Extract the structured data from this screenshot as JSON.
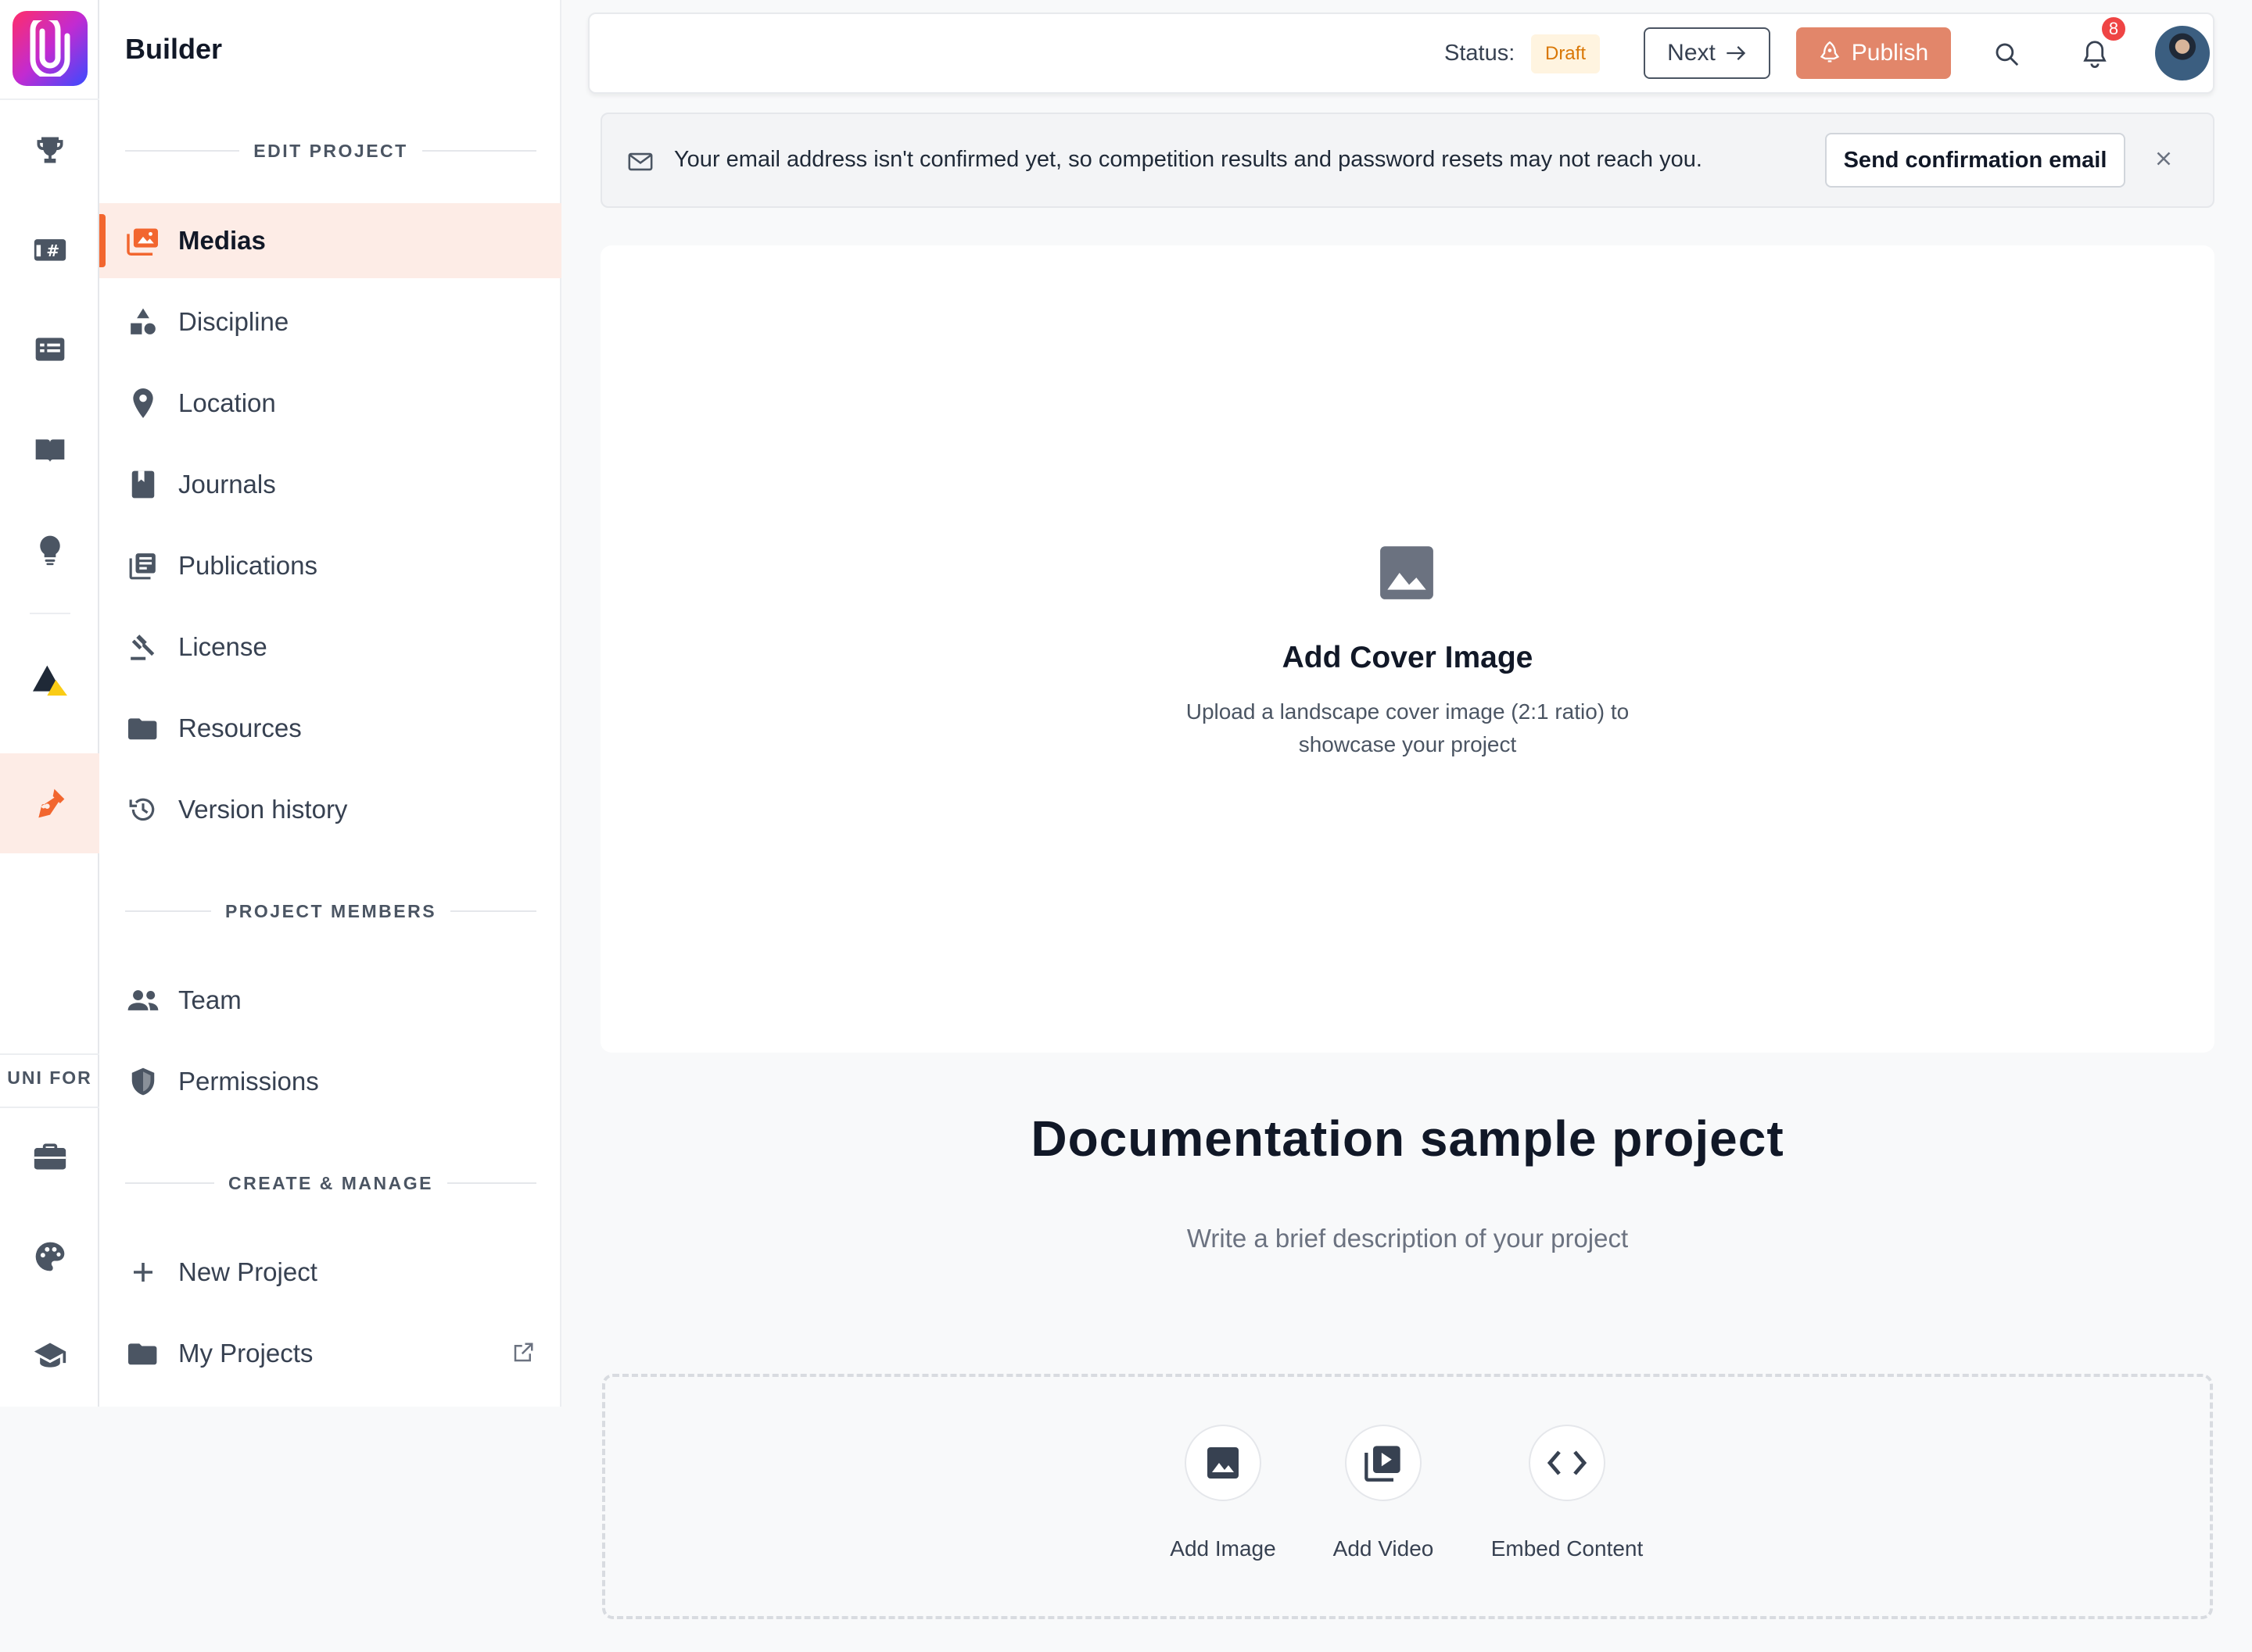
{
  "rail": {
    "icons": [
      "trophy-icon",
      "hashtag-card-icon",
      "news-icon",
      "book-open-icon",
      "lightbulb-icon",
      "brand-triangle-icon",
      "pen-nib-icon",
      "briefcase-icon",
      "palette-icon",
      "graduation-cap-icon"
    ],
    "section_label": "UNI FOR"
  },
  "sidebar": {
    "title": "Builder",
    "sections": {
      "edit_project": "EDIT PROJECT",
      "project_members": "PROJECT MEMBERS",
      "create_manage": "CREATE & MANAGE"
    },
    "items": [
      {
        "label": "Medias",
        "icon": "images-icon",
        "active": true
      },
      {
        "label": "Discipline",
        "icon": "shapes-icon"
      },
      {
        "label": "Location",
        "icon": "map-pin-icon"
      },
      {
        "label": "Journals",
        "icon": "journal-icon"
      },
      {
        "label": "Publications",
        "icon": "publications-icon"
      },
      {
        "label": "License",
        "icon": "gavel-icon"
      },
      {
        "label": "Resources",
        "icon": "folder-icon"
      },
      {
        "label": "Version history",
        "icon": "history-icon"
      }
    ],
    "members": [
      {
        "label": "Team",
        "icon": "team-icon"
      },
      {
        "label": "Permissions",
        "icon": "shield-icon"
      }
    ],
    "manage": [
      {
        "label": "New Project",
        "icon": "plus-icon"
      },
      {
        "label": "My Projects",
        "icon": "folder-icon"
      }
    ]
  },
  "topbar": {
    "status_label": "Status:",
    "status_value": "Draft",
    "next_label": "Next",
    "publish_label": "Publish",
    "notification_count": "8",
    "colors": {
      "publish": "#e2866a",
      "badge": "#ef4444",
      "draft_text": "#d97706"
    }
  },
  "banner": {
    "message": "Your email address isn't confirmed yet, so competition results and password resets may not reach you.",
    "button": "Send confirmation email"
  },
  "cover": {
    "title": "Add Cover Image",
    "subtitle_line1": "Upload a landscape cover image (2:1 ratio) to",
    "subtitle_line2": "showcase your project"
  },
  "project": {
    "title": "Documentation sample project",
    "description_placeholder": "Write a brief description of your project"
  },
  "add_media": {
    "image": "Add Image",
    "video": "Add Video",
    "embed": "Embed Content"
  },
  "accent_color": "#f2662f"
}
